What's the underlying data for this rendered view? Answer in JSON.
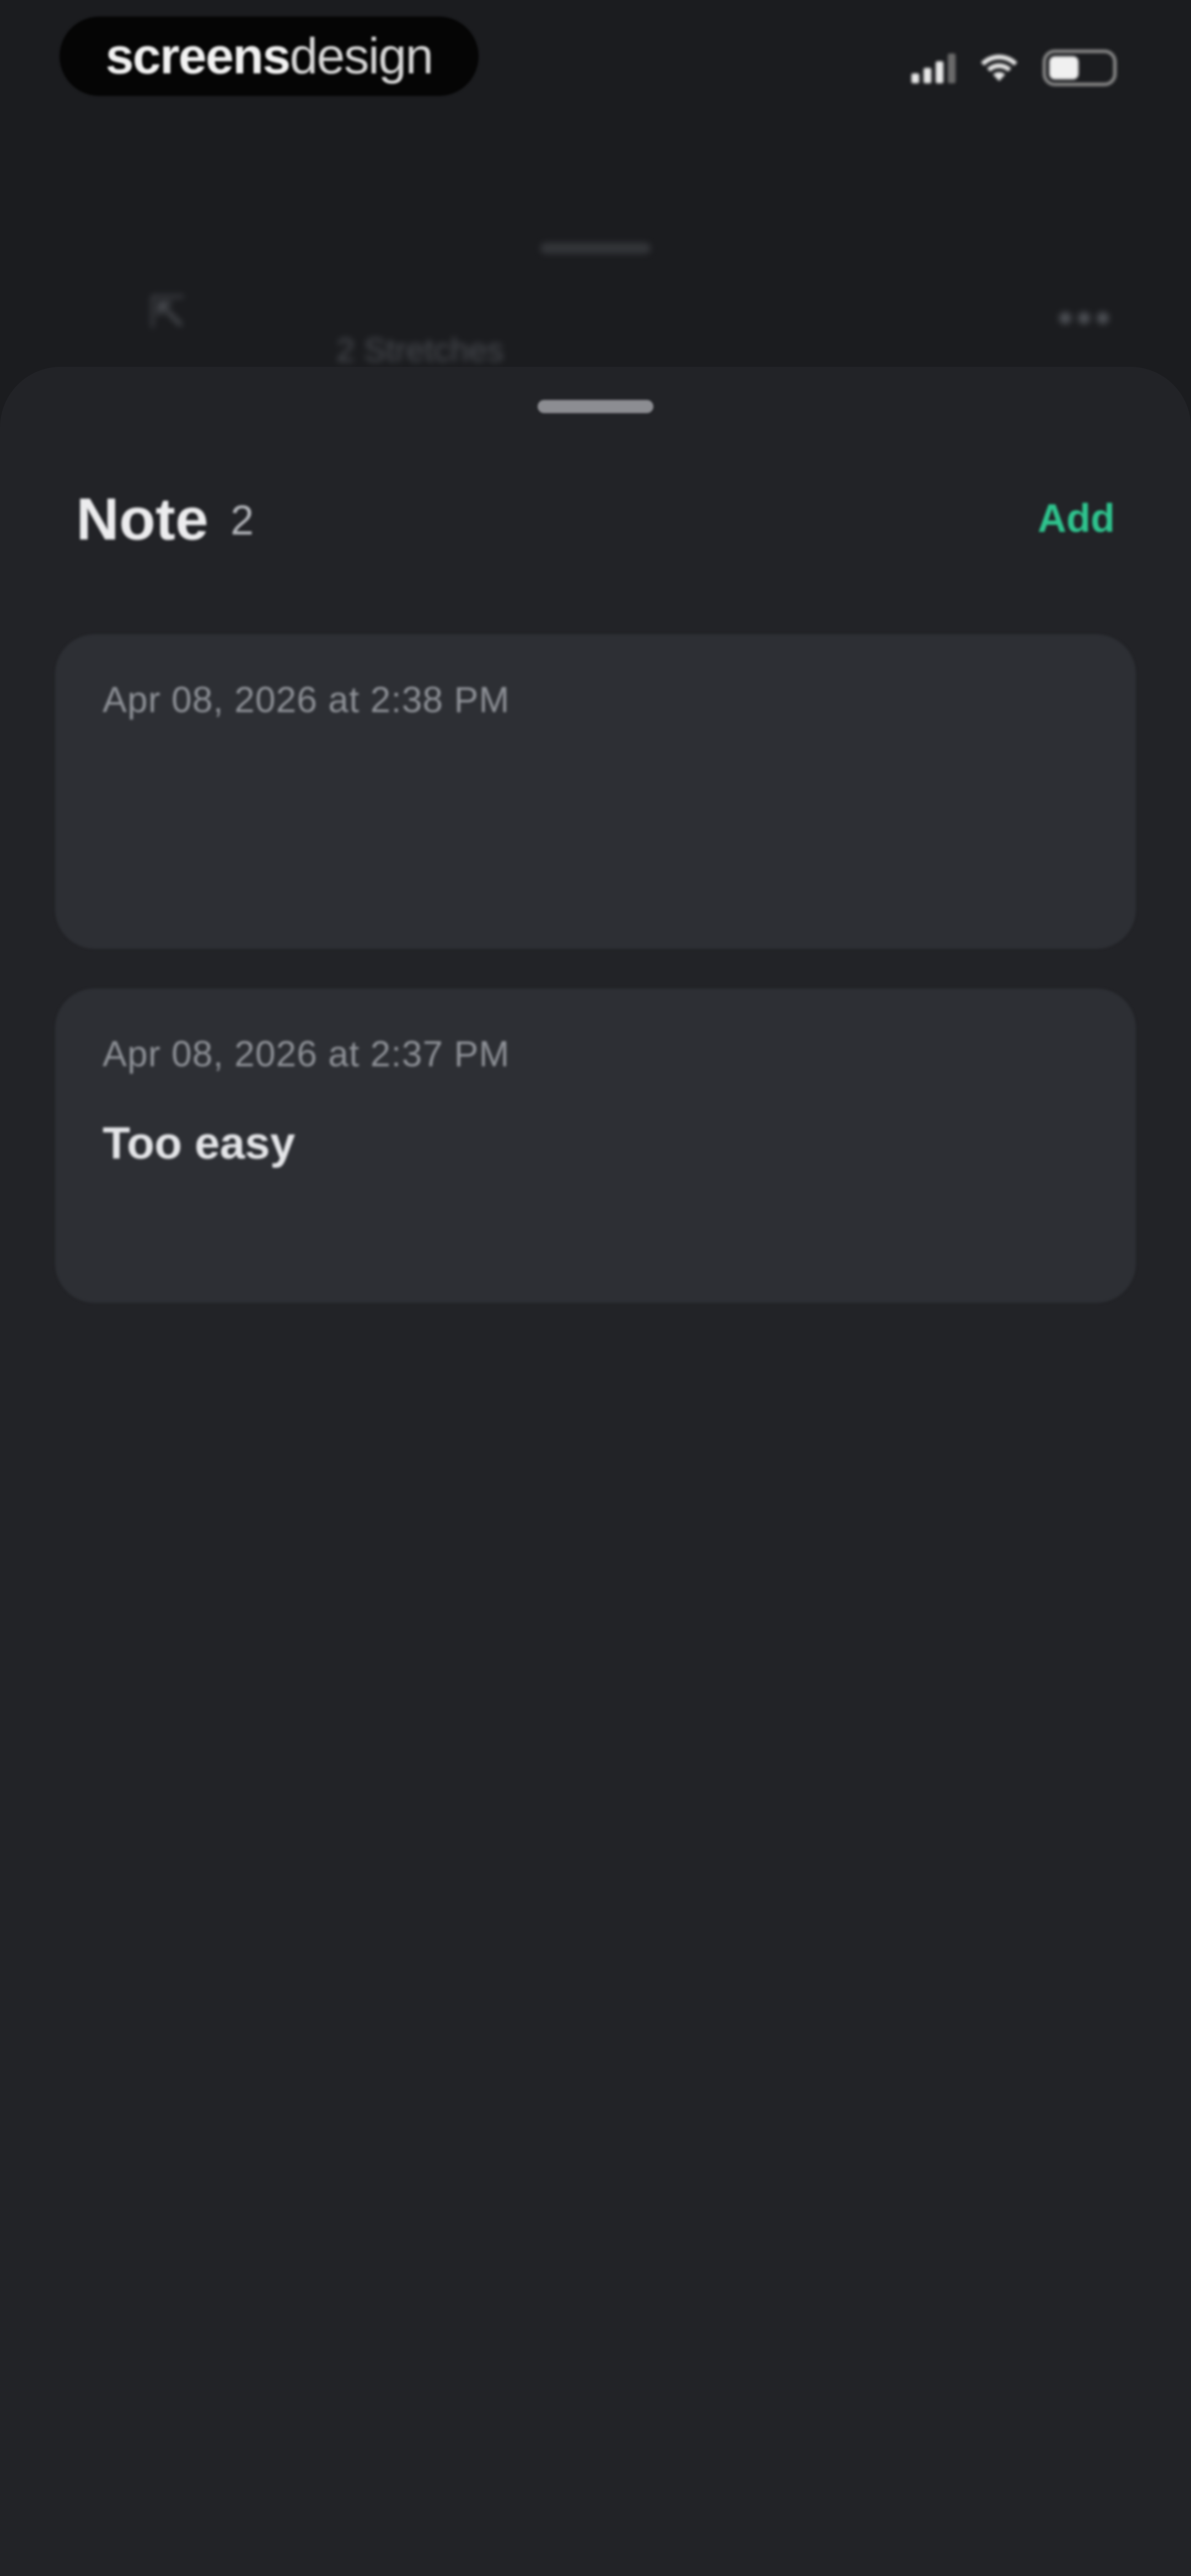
{
  "status_bar": {
    "brand_primary": "screens",
    "brand_secondary": "design",
    "battery_level": 0.48,
    "icons": [
      "signal-icon",
      "wifi-icon",
      "battery-icon"
    ]
  },
  "background_page": {
    "title": "2 Stretches",
    "back_icon": "back-arrow-icon",
    "more_icon": "more-horizontal-icon"
  },
  "sheet": {
    "title": "Note",
    "count": "2",
    "add_label": "Add",
    "accent_color": "#2fc48e",
    "notes": [
      {
        "date": "Apr 08, 2026 at 2:38 PM",
        "text": ""
      },
      {
        "date": "Apr 08, 2026 at 2:37 PM",
        "text": "Too easy"
      }
    ]
  }
}
